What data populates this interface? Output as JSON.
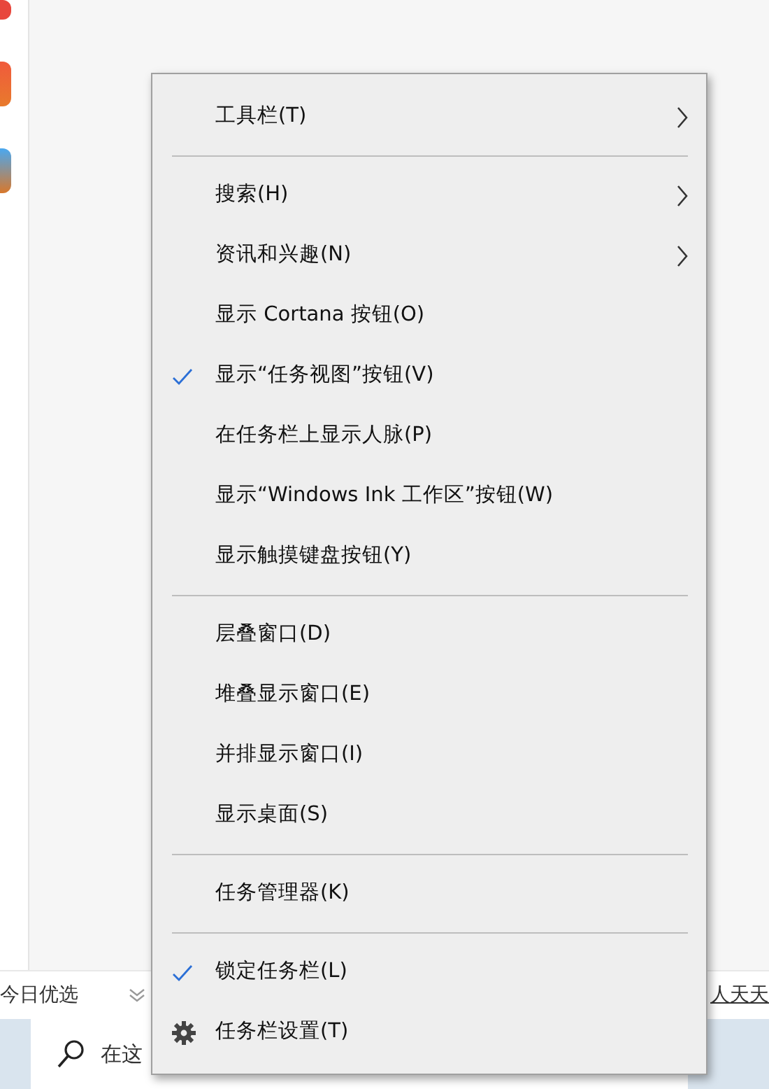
{
  "feed_bar": {
    "left_label": "今日优选",
    "right_label": "人天天"
  },
  "taskbar": {
    "search": {
      "placeholder": "在这"
    }
  },
  "context_menu": {
    "groups": [
      {
        "items": [
          {
            "label": "工具栏(T)",
            "kind": "submenu"
          }
        ]
      },
      {
        "items": [
          {
            "label": "搜索(H)",
            "kind": "submenu"
          },
          {
            "label": "资讯和兴趣(N)",
            "kind": "submenu"
          },
          {
            "label": "显示 Cortana 按钮(O)",
            "kind": "toggle",
            "checked": false
          },
          {
            "label": "显示“任务视图”按钮(V)",
            "kind": "toggle",
            "checked": true
          },
          {
            "label": "在任务栏上显示人脉(P)",
            "kind": "toggle",
            "checked": false
          },
          {
            "label": "显示“Windows Ink 工作区”按钮(W)",
            "kind": "toggle",
            "checked": false
          },
          {
            "label": "显示触摸键盘按钮(Y)",
            "kind": "toggle",
            "checked": false
          }
        ]
      },
      {
        "items": [
          {
            "label": "层叠窗口(D)",
            "kind": "command"
          },
          {
            "label": "堆叠显示窗口(E)",
            "kind": "command"
          },
          {
            "label": "并排显示窗口(I)",
            "kind": "command"
          },
          {
            "label": "显示桌面(S)",
            "kind": "command"
          }
        ]
      },
      {
        "items": [
          {
            "label": "任务管理器(K)",
            "kind": "command"
          }
        ]
      },
      {
        "items": [
          {
            "label": "锁定任务栏(L)",
            "kind": "toggle",
            "checked": true
          },
          {
            "label": "任务栏设置(T)",
            "kind": "settings"
          }
        ]
      }
    ]
  }
}
